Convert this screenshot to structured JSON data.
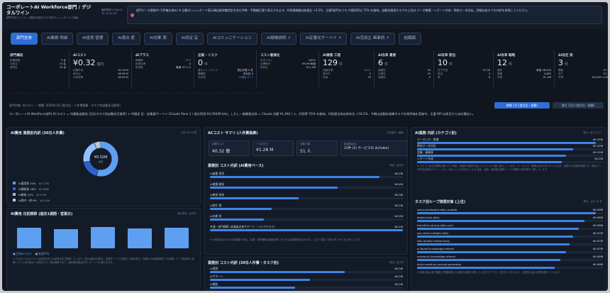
{
  "header": {
    "brand": "コーポレートAI Workforce部門 / デジタルワイン",
    "brand_sub": "部門平均ファイル・自動化可能タスク分析ダッシュボード (本番)",
    "update_label": "最終更新 2026-01-18 14:15 JST",
    "notice": "部門データ更新中 (1件集計済み) ※ 自動ダッシュボード表示順は経済職判定を含む件数・手動補正値で表示されます。AI投資総額は前週比 +3.2%、主要6部門のうち AI適用率は 75% を維持。自動化推奨タスクの上位は データ整備・レポート作成・問合せ一次対応。詳細は各タブの内訳を参照してください。"
  },
  "tabs": [
    {
      "label": "部門全体",
      "active": true
    },
    {
      "label": "AI業務 明細"
    },
    {
      "label": "AI投資 管理"
    },
    {
      "label": "AI適合 度"
    },
    {
      "label": "AI効果 測"
    },
    {
      "label": "AI改定 定"
    },
    {
      "label": "AIコミュニケーション"
    },
    {
      "label": "AI戦略説明 ↗"
    },
    {
      "label": "AI定着化サーベイ ↗"
    },
    {
      "label": "AI活用企 画事例 ↗"
    },
    {
      "label": "組織図"
    }
  ],
  "kpis": [
    {
      "title": "部門構成",
      "value": "",
      "rows": [
        [
          "従業員数",
          "5 名"
        ],
        [
          "AI担当",
          "15 名"
        ],
        [
          "部門計",
          "15 名"
        ]
      ]
    },
    {
      "title": "AIコスト",
      "value": "¥0.32",
      "unit": "億円",
      "rows": [
        [
          "月間平均",
          "¥1.28 M"
        ],
        [
          "前月比",
          "¥0.69 M"
        ],
        [
          "AI利用率",
          "¥0.69 M"
        ]
      ]
    },
    {
      "title": "AIプラス",
      "value": "",
      "rows": [
        [
          "稼働率",
          "75%"
        ],
        [
          "投資比率",
          "4"
        ],
        [
          "投資後",
          "最適 37.2 %"
        ]
      ]
    },
    {
      "title": "品質・リスク",
      "value": "0",
      "unit": "件",
      "rows": [
        [
          "重大インシデント",
          "発生件数 0 件"
        ],
        [
          "要確認",
          "未対応 0"
        ],
        [
          "対応済",
          "AI適合 5 / 5"
        ]
      ]
    },
    {
      "title": "コスト最適化",
      "value": "",
      "rows": [
        [
          "月次コスト",
          "100%"
        ],
        [
          "目標差分",
          "¥9.5M 削減"
        ],
        [
          "前年比",
          "¥11.2M"
        ]
      ]
    },
    {
      "title": "AI業務 工程",
      "value": "129",
      "unit": "件",
      "rows": [
        [
          "自動化済",
          "100%"
        ],
        [
          "進行中",
          "0"
        ],
        [
          "計画",
          "29"
        ]
      ]
    },
    {
      "title": "AI改革 重要",
      "value": "6",
      "unit": "件",
      "rows": [
        [
          "高優先",
          "16"
        ],
        [
          "中優先",
          "10"
        ],
        [
          "低優先",
          "5"
        ]
      ]
    },
    {
      "title": "AI改革 割当",
      "value": "10",
      "unit": "件",
      "rows": [
        [
          "完了予定",
          "07-06"
        ],
        [
          "担当",
          "4"
        ],
        [
          "残",
          "6"
        ]
      ]
    },
    {
      "title": "AI改革 戦略",
      "value": "12",
      "unit": "件",
      "rows": [
        [
          "進捗",
          "承認 38/100"
        ],
        [
          "提案",
          "4,482"
        ],
        [
          "予算",
          "¥1.2M"
        ]
      ]
    },
    {
      "title": "AI改定 実",
      "value": "3",
      "unit": "件",
      "rows": [
        [
          "開始",
          "07-14"
        ],
        [
          "完了",
          "07-18"
        ],
        [
          "予算",
          "¥3,400〜4,500"
        ]
      ]
    }
  ],
  "meta": {
    "bar_label": "部門対象: AIコスト ／ 期間: 2026年1月 (前月比・人件費換算・タスク別自動化可能率)",
    "btn_a": "期間 1月 (前月比・換算)",
    "btn_b": "前月 12月 (前月比・換算)",
    "desc": "コーポレートAI Workforce部門 ACコスト = AI業務自動化 (月次タスク別自動化可能率) × AI適定 定・従業員サーベイ (Claude Pane 3 / 部分利用 ¥4,500/M tok)。しかし一般業務全体 = Claude 月額 ¥1,400 / 人、利用率 55% を維持。AI投資全体は前年比 +18.2%、今期は自動化候補タスクの再評価を実施中。主要 KPI は前月からほぼ横ばい。"
  },
  "panels": {
    "donut": {
      "title": "AI費用 業務別内訳 (30日人件費)",
      "note": "合計 ¥0.32億",
      "center": "¥0.32M",
      "center_sub": "合計",
      "legend": [
        {
          "name": "AI運用費 54%",
          "value": "¥0.17M",
          "color": "#5f9ff2"
        },
        {
          "name": "AI開発費 18%",
          "value": "¥0.06M",
          "color": "#2d63c8"
        },
        {
          "name": "AI教育 22%",
          "value": "¥0.07M",
          "color": "#8fc2ff"
        },
        {
          "name": "AI保守・他 6%",
          "value": "¥0.02M",
          "color": "#b9c6d8"
        }
      ]
    },
    "weekly": {
      "title": "AI費用 日別推移 (過去1週間・営業日)",
      "note": "表示単位: 百万円",
      "bars": [
        0.8,
        0.76,
        0.82,
        0.78,
        0.8
      ],
      "legend_a": "■ 日別AIコスト",
      "legend_b": "■ 前週平均",
      "footnote": "※ 1日あたりのAIコストは前週平均とほぼ同水準で推移しています。週末は集計対象外。営業日ベースで換算した値を表示。詳細は AI費用明細タブを参照。データ取得元: 経理システム月次締め / AI利用ログ。値は概算であり、最終確定値は月次レポートで公開されます。"
    },
    "cost": {
      "title": "ACコスト サマリ (人件費換算)",
      "note": "月次集計 / 最新",
      "cards": [
        {
          "label": "月間コスト",
          "value": "¥0.32 億"
        },
        {
          "label": "一人あたり",
          "value": "¥1.28 M"
        },
        {
          "label": "対象人数",
          "value": "51 人"
        },
        {
          "label": "削減見込み",
          "value": "15件 (5) サービスの み(Fable)"
        }
      ]
    },
    "dept": {
      "title": "業務別 コスト内訳 (AI費用ベース)",
      "note": "単位: 百万円",
      "rows": [
        {
          "label": "AI基盤 運用",
          "value": "¥0.5M",
          "frac": 0.88
        },
        {
          "label": "AI基盤 開発",
          "value": "¥0.4M",
          "frac": 0.66
        },
        {
          "label": "AI教育 研修",
          "value": "¥0.3M",
          "frac": 0.46
        },
        {
          "label": "AI保守 運",
          "value": "¥0.2M",
          "frac": 0.32
        },
        {
          "label": "AI効果 測",
          "value": "¥0.2M",
          "frac": 0.28
        },
        {
          "label": "共通・部門横断 (従業員全体サポート・ヘルプデスク)",
          "value": "¥0.1M",
          "frac": 1.0
        }
      ],
      "footnote": "※ AI費用は月次の人件費換算で算出。共通・部門横断は複数部門にまたがる支援業務を含みます。上位 5 項目で全体の約 78% を占めています。"
    },
    "task": {
      "title": "業務別 コスト内訳 (30日人件費・タスク別)",
      "note": "単位: 百万円",
      "rows": [
        {
          "label": "AI運用",
          "value": "¥0.3M",
          "frac": 0.7
        },
        {
          "label": "AIサポート",
          "value": "¥0.2M",
          "frac": 0.52
        },
        {
          "label": "AI開発",
          "value": "¥0.2M",
          "frac": 0.44
        }
      ]
    },
    "right_top": {
      "title": "AI業務 内訳 (カテゴリ別)",
      "note": "表示: 全カテゴリ",
      "rows": [
        {
          "label": "データ入力・整備",
          "value": "¥0.25M",
          "frac": 0.96
        },
        {
          "label": "問合せ一次対応",
          "value": "¥0.22M",
          "frac": 0.84
        },
        {
          "label": "会議・議事録",
          "value": "¥0.21M",
          "frac": 0.8
        },
        {
          "label": "レポート作成",
          "value": "¥0.2M",
          "frac": 0.78
        },
        {
          "label": "システム監視",
          "value": "¥0.19M",
          "frac": 0.74
        }
      ],
      "footnote": "※ カテゴリは社内業務分類 v3 に準拠。自動化可能率の高いカテゴリから順に表示しています。データ入力・整備は全体の約 24% を占め、最優先の自動化候補です。問合せ一次対応は既存のチャットボット導入により前月から 6 pt 改善。会議・議事録は要約ツールの展開で利用率が上昇しています。"
    },
    "right_bottom": {
      "title": "タスク別ループ推奨対象 (上位)",
      "note": "表示: 上位 10 件",
      "rows": [
        {
          "label": "sales-dashboard-daily-update",
          "value": "¥0.09M",
          "frac": 0.96
        },
        {
          "label": "digital-task-daily",
          "value": "¥0.08M",
          "frac": 0.9
        },
        {
          "label": "transform-group-daily-sync",
          "value": "¥0.08M",
          "frac": 0.87
        },
        {
          "label": "sns-stock-outlight-daily",
          "value": "¥0.07M",
          "frac": 0.84
        },
        {
          "label": "skill-quality-review-daily",
          "value": "¥0.07M",
          "frac": 0.82
        },
        {
          "label": "ai-board-knowledge-refresh",
          "value": "¥0.07M",
          "frac": 0.8
        },
        {
          "label": "review-ai-knowledge-refresh",
          "value": "¥0.06M",
          "frac": 0.77
        },
        {
          "label": "daily-meeting-concept-generator",
          "value": "¥0.06M",
          "frac": 0.74
        }
      ],
      "footnote": "※ 推奨対象は実行頻度と所要時間から自動化効果を試算した上位タスクです。日次タスクを中心に、定型性の高い処理を優先しています。"
    }
  },
  "colors": {
    "accent": "#2d6fd6",
    "bar": "#3e84e6",
    "bg": "#10151e"
  }
}
